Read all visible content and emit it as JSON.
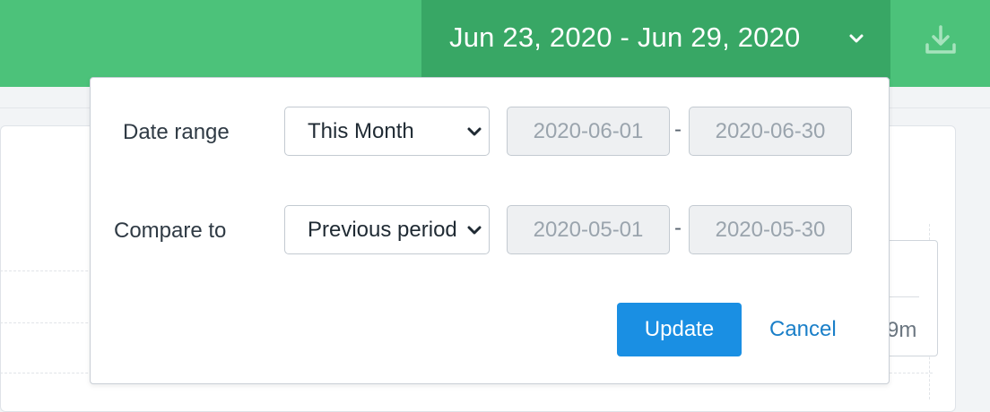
{
  "header": {
    "date_range_text": "Jun 23, 2020 - Jun 29, 2020",
    "toggle_icon": "chevron-down-icon",
    "download_icon": "download-icon"
  },
  "background": {
    "tooltip_value": "9m"
  },
  "popover": {
    "date_range": {
      "label": "Date range",
      "selected": "This Month",
      "start": "2020-06-01",
      "separator": "-",
      "end": "2020-06-30"
    },
    "compare": {
      "label": "Compare to",
      "selected": "Previous period",
      "start": "2020-05-01",
      "separator": "-",
      "end": "2020-05-30"
    },
    "update_label": "Update",
    "cancel_label": "Cancel"
  },
  "colors": {
    "header_green": "#4cc27a",
    "toggle_green": "#38a765",
    "primary_blue": "#1a8fe3",
    "link_blue": "#1a7fc8"
  }
}
